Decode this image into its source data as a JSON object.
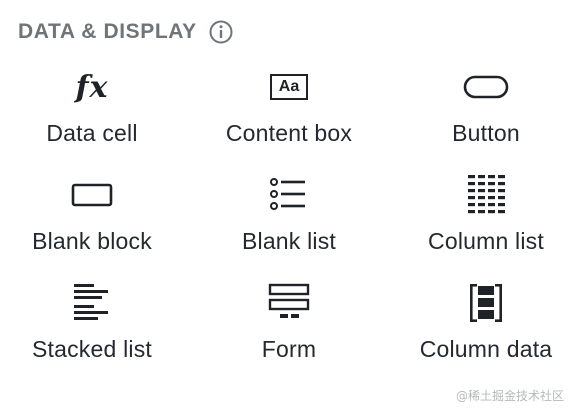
{
  "section": {
    "title": "DATA & DISPLAY",
    "info_icon": "info-icon"
  },
  "tiles": [
    {
      "label": "Data cell",
      "icon": "function-icon"
    },
    {
      "label": "Content box",
      "icon": "text-box-icon"
    },
    {
      "label": "Button",
      "icon": "button-icon"
    },
    {
      "label": "Blank block",
      "icon": "rectangle-icon"
    },
    {
      "label": "Blank list",
      "icon": "bullet-list-icon"
    },
    {
      "label": "Column list",
      "icon": "column-list-icon"
    },
    {
      "label": "Stacked list",
      "icon": "stacked-list-icon"
    },
    {
      "label": "Form",
      "icon": "form-icon"
    },
    {
      "label": "Column data",
      "icon": "column-data-icon"
    }
  ],
  "icon_glyphs": {
    "data_cell": "fx",
    "content_box": "Aa"
  },
  "watermark": "@稀土掘金技术社区",
  "colors": {
    "title": "#6f7479",
    "icon": "#1f2328",
    "label": "#24292f"
  }
}
